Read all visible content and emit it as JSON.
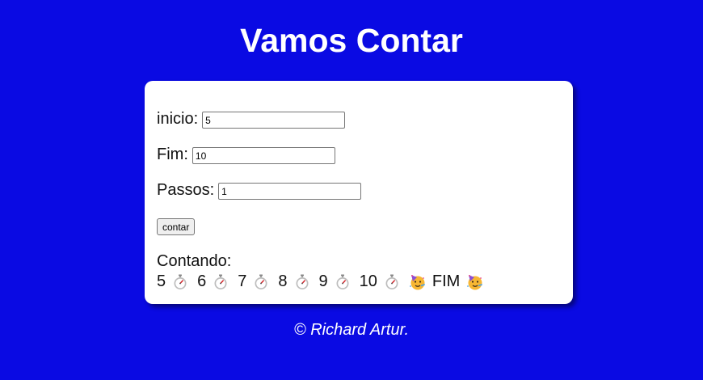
{
  "page": {
    "title": "Vamos Contar",
    "footer": "© Richard Artur."
  },
  "form": {
    "inicio_label": "inicio:",
    "inicio_value": "5",
    "fim_label": "Fim:",
    "fim_value": "10",
    "passos_label": "Passos:",
    "passos_value": "1",
    "button_label": "contar"
  },
  "result": {
    "heading": "Contando:",
    "numbers": [
      "5",
      "6",
      "7",
      "8",
      "9",
      "10"
    ],
    "step_icon": "stopwatch-icon",
    "end_icon": "partying-face-icon",
    "end_label": "FIM"
  },
  "colors": {
    "background": "#0a0ae3",
    "card": "#ffffff",
    "text": "#111111"
  }
}
